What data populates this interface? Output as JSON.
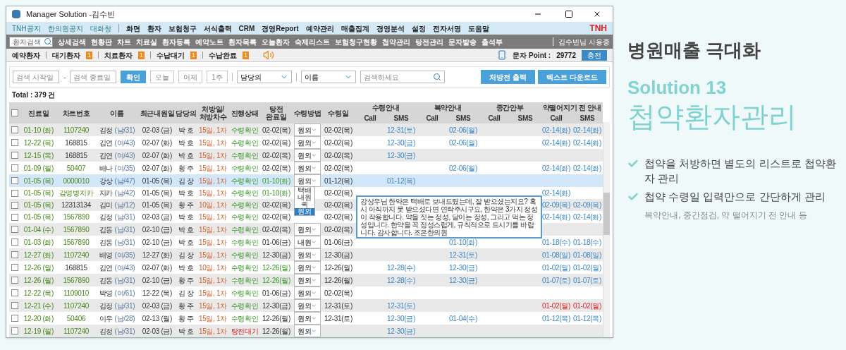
{
  "window": {
    "title": "Manager Solution -김수빈"
  },
  "menu_bar": {
    "notices": [
      "TNH공지",
      "한의원공지",
      "대화창"
    ],
    "items": [
      "화면",
      "환자",
      "보험청구",
      "서식출력",
      "CRM",
      "경영Report",
      "예약관리",
      "매출집계",
      "경영분석",
      "설정",
      "전자서명",
      "도움말"
    ],
    "brand": "TNH"
  },
  "toolbar": {
    "search": {
      "placeholder": "환자검색"
    },
    "items": [
      "상세검색",
      "현황판",
      "차트",
      "치료실",
      "환자등록",
      "예약노트",
      "환자목록",
      "오늘환자",
      "숙제리스트",
      "보험청구현황",
      "첩약관리",
      "탕전관리",
      "문자발송",
      "출석부"
    ],
    "user": "김수빈님 사용중"
  },
  "status_tabs": [
    {
      "label": "예약환자"
    },
    {
      "label": "대기환자",
      "count": "1"
    },
    {
      "label": "치료환자",
      "count": "1"
    },
    {
      "label": "수납대기",
      "count": "1"
    },
    {
      "label": "수납완료",
      "count": "1"
    }
  ],
  "sms_points": {
    "label": "문자 Point :",
    "value": "29772",
    "button": "충전"
  },
  "filter": {
    "start": {
      "placeholder": "검색 시작일"
    },
    "separator": "-",
    "end": {
      "placeholder": "검색 종료일"
    },
    "confirm": "확인",
    "ranges": [
      "오늘",
      "어제",
      "1주"
    ],
    "doctor_select": "담당의",
    "field_select": "이름",
    "query": {
      "placeholder": "검색하세요"
    },
    "actions": [
      "처방전 출력",
      "텍스트 다운로드"
    ]
  },
  "total": "Total : 379 건",
  "table": {
    "all_checked": false,
    "columns": [
      "진료일",
      "차트번호",
      "이름",
      "최근내원일",
      "담당의",
      "처방일/\n처방차수",
      "진행상태",
      "탕전\n완료일",
      "수령방법",
      "수령일"
    ],
    "groups": [
      {
        "label": "수령안내",
        "sub": [
          "Call",
          "SMS"
        ]
      },
      {
        "label": "복약안내",
        "sub": [
          "Call",
          "SMS"
        ]
      },
      {
        "label": "중간안부",
        "sub": [
          "Call",
          "SMS"
        ]
      },
      {
        "label": "약떨어지기 전 안내",
        "sub": [
          "Call",
          "SMS"
        ]
      }
    ],
    "rows": [
      {
        "date": "01-10 (화)",
        "chart": "1107240",
        "chart_green": true,
        "name": "김정",
        "info": "(남/31)",
        "last_visit": "02-03 (금)",
        "doctor": "박 호",
        "rx": "15일, 1차",
        "status": {
          "text": "수령확인",
          "kind": "received"
        },
        "decoction": "02-02(목)",
        "decoction_green": false,
        "method": "원외",
        "receive": "02-02(목)",
        "notes": {
          "guide_sms": "12-31(토)",
          "dose_sms": "02-06(월)",
          "end_call": "02-14(화)",
          "end_sms": "02-14(화)"
        },
        "overdue": false,
        "checked": false,
        "selected": false
      },
      {
        "date": "12-22 (목)",
        "chart": "168815",
        "chart_green": false,
        "name": "김연",
        "info": "(여/43)",
        "last_visit": "02-07 (화)",
        "doctor": "박 호",
        "rx": "15일, 1차",
        "status": {
          "text": "수령확인",
          "kind": "received"
        },
        "decoction": "02-02(목)",
        "decoction_green": false,
        "method": "원외",
        "receive": "02-02(목)",
        "notes": {
          "guide_sms": "12-30(금)",
          "dose_sms": "02-06(월)",
          "end_call": "02-14(화)",
          "end_sms": "02-14(화)"
        },
        "overdue": false,
        "checked": false,
        "selected": false
      },
      {
        "date": "12-15 (목)",
        "chart": "168815",
        "chart_green": false,
        "name": "김연",
        "info": "(여/43)",
        "last_visit": "02-07 (화)",
        "doctor": "박 호",
        "rx": "15일, 1차",
        "status": {
          "text": "수령확인",
          "kind": "received"
        },
        "decoction": "02-02(목)",
        "decoction_green": false,
        "method": "원외",
        "receive": "02-02(목)",
        "notes": {
          "guide_sms": "12-30(금)"
        },
        "checked": false,
        "selected": false
      },
      {
        "date": "01-09 (월)",
        "chart": "50407",
        "chart_green": true,
        "name": "배나",
        "info": "(여/35)",
        "last_visit": "02-07 (화)",
        "doctor": "황 주",
        "rx": "15일, 1차",
        "status": {
          "text": "수령확인",
          "kind": "received"
        },
        "decoction": "02-02(목)",
        "decoction_green": false,
        "method": "원외",
        "receive": "02-02(목)",
        "notes": {
          "dose_sms": "02-06(월)",
          "end_call": "02-14(화)",
          "end_sms": "02-14(화)"
        },
        "overdue": false,
        "checked": false,
        "selected": false
      },
      {
        "date": "01-05 (목)",
        "chart": "0000010",
        "chart_green": true,
        "name": "강상",
        "info": "(남/47)",
        "last_visit": "01-05 (목)",
        "doctor": "김 장",
        "rx": "15일, 1차",
        "status": {
          "text": "수령확인",
          "kind": "received"
        },
        "decoction": "01-10(화)",
        "decoction_green": true,
        "method": "원외",
        "method_menu": [
          {
            "label": "택배",
            "selected": false
          },
          {
            "label": "내원",
            "selected": false
          },
          {
            "label": "퀵",
            "selected": false
          },
          {
            "label": "원외",
            "selected": true
          }
        ],
        "receive": "01-12(목)",
        "notes": {
          "guide_sms": "01-12(목)"
        },
        "checked": false,
        "selected": true
      },
      {
        "date": "01-05 (목)",
        "chart": "감영병지카",
        "chart_green": true,
        "name": "지카",
        "info": "(남/42)",
        "last_visit": "01-05 (목)",
        "doctor": "박 호",
        "rx": "15일, 1차",
        "status": {
          "text": "수령확인",
          "kind": "received"
        },
        "decoction": "01-10(화)",
        "decoction_green": true,
        "receive": "02-02(목)",
        "notes": {
          "end_call": "02-14(화)"
        },
        "memo": "강상우님 한약은 택배로 보내드렸는데, 잘 받으셨는지요? 혹시 아직까지 못 받으셨다면 연락주시구요, 한약은 3가지 정성이 작용합니다. 약을 짓는 정성, 달이는 정성, 그리고 먹는 정성입니다. 한약을 꼭 정성스럽게, 규칙적으로 드시기를 바랍니다. 감사합니다. 조은한의원",
        "overdue": false,
        "checked": false,
        "selected": false
      },
      {
        "date": "01-05 (목)",
        "chart": "12313134",
        "chart_green": false,
        "name": "김미",
        "info": "(남/12)",
        "last_visit": "01-05 (목)",
        "doctor": "황 주",
        "rx": "10일, 1차",
        "status": {
          "text": "수령확인",
          "kind": "received"
        },
        "decoction": "02-02(목)",
        "decoction_green": false,
        "receive": "02-02(목)",
        "notes": {
          "end_call": "02-09(목)",
          "end_sms": "02-09(목)"
        },
        "overdue": false,
        "checked": false,
        "selected": false
      },
      {
        "date": "01-05 (목)",
        "chart": "1567890",
        "chart_green": true,
        "name": "김정",
        "info": "(남/31)",
        "last_visit": "02-03 (금)",
        "doctor": "박 호",
        "rx": "15일, 1차",
        "status": {
          "text": "수령확인",
          "kind": "received"
        },
        "decoction": "02-02(목)",
        "decoction_green": false,
        "receive": "02-02(목)",
        "notes": {
          "end_call": "02-14(화)",
          "end_sms": "02-14(화)"
        },
        "overdue": false,
        "checked": false,
        "selected": false
      },
      {
        "date": "01-04 (수)",
        "chart": "1567890",
        "chart_green": true,
        "name": "김동",
        "info": "(남/31)",
        "last_visit": "02-10 (금)",
        "doctor": "박 호",
        "rx": "15일, 1차",
        "status": {
          "text": "수령확인",
          "kind": "received"
        },
        "decoction": "02-02(목)",
        "decoction_green": false,
        "method": "원외",
        "receive": "02-02(목)",
        "notes": {},
        "checked": false,
        "selected": false
      },
      {
        "date": "01-03 (화)",
        "chart": "1567890",
        "chart_green": true,
        "name": "김동",
        "info": "(남/31)",
        "last_visit": "02-10 (금)",
        "doctor": "박 호",
        "rx": "15일, 1차",
        "status": {
          "text": "수령확인",
          "kind": "received"
        },
        "decoction": "01-06(금)",
        "decoction_green": false,
        "method": "내원",
        "receive": "01-06(금)",
        "notes": {
          "dose_sms": "01-10(화)",
          "end_call": "01-18(수)",
          "end_sms": "01-18(수)"
        },
        "overdue": false,
        "checked": false,
        "selected": false
      },
      {
        "date": "12-27 (화)",
        "chart": "1107240",
        "chart_green": true,
        "name": "배영",
        "info": "(여/35)",
        "last_visit": "12-27 (화)",
        "doctor": "김 장",
        "rx": "15일, 1차",
        "status": {
          "text": "수령확인",
          "kind": "received"
        },
        "decoction": "12-30(금)",
        "decoction_green": false,
        "method": "원외",
        "receive": "12-30(금)",
        "notes": {
          "dose_sms": "12-31(토)",
          "end_call": "01-08(일)",
          "end_sms": "01-08(일)"
        },
        "overdue": false,
        "checked": false,
        "selected": false
      },
      {
        "date": "12-26 (월)",
        "chart": "168815",
        "chart_green": false,
        "name": "김연",
        "info": "(여/43)",
        "last_visit": "02-07 (화)",
        "doctor": "박 호",
        "rx": "10일, 1차",
        "status": {
          "text": "수령확인",
          "kind": "received"
        },
        "decoction": "12-26(월)",
        "decoction_green": true,
        "method": "원외",
        "receive": "12-26(월)",
        "notes": {
          "guide_sms": "12-28(수)",
          "dose_sms": "12-30(금)",
          "end_call": "01-02(월)",
          "end_sms": "01-02(월)"
        },
        "overdue": false,
        "checked": false,
        "selected": false
      },
      {
        "date": "12-26 (월)",
        "chart": "1567890",
        "chart_green": true,
        "name": "김동",
        "info": "(남/31)",
        "last_visit": "02-10 (금)",
        "doctor": "황 주",
        "rx": "15일, 1차",
        "status": {
          "text": "수령확인",
          "kind": "received"
        },
        "decoction": "12-26(월)",
        "decoction_green": true,
        "method": "원외",
        "receive": "12-26(월)",
        "notes": {
          "guide_sms": "12-28(수)",
          "dose_sms": "12-30(금)",
          "end_call": "01-07(토)",
          "end_sms": "01-07(토)"
        },
        "overdue": false,
        "checked": false,
        "selected": false
      },
      {
        "date": "12-22 (목)",
        "chart": "1109010",
        "chart_green": true,
        "name": "박영",
        "info": "(여/61)",
        "last_visit": "12-22 (목)",
        "doctor": "김 장",
        "rx": "15일, 1차",
        "status": {
          "text": "수령확인",
          "kind": "received"
        },
        "decoction": "01-06(금)",
        "decoction_green": false,
        "method": "원외",
        "receive": "02-02(목)",
        "notes": {},
        "checked": false,
        "selected": false
      },
      {
        "date": "12-21 (수)",
        "chart": "1107240",
        "chart_green": true,
        "name": "김정",
        "info": "(남/31)",
        "last_visit": "02-03 (금)",
        "doctor": "황 주",
        "rx": "15일, 1차",
        "status": {
          "text": "수령확인",
          "kind": "received"
        },
        "decoction": "12-30(금)",
        "decoction_green": false,
        "method": "원외",
        "receive": "12-31(토)",
        "notes": {
          "guide_sms": "12-31(토)",
          "end_call": "01-02(월)",
          "end_sms": "01-02(월)"
        },
        "overdue": true,
        "checked": false,
        "selected": false
      },
      {
        "date": "12-20 (화)",
        "chart": "50406",
        "chart_green": true,
        "name": "이우",
        "info": "(남/28)",
        "last_visit": "02-13 (월)",
        "doctor": "황 주",
        "rx": "15일, 1차",
        "status": {
          "text": "수령확인",
          "kind": "received"
        },
        "decoction": "12-26(월)",
        "decoction_green": false,
        "method": "원외",
        "receive": "12-31(토)",
        "notes": {
          "guide_sms": "12-30(금)",
          "dose_sms": "01-04(수)",
          "end_call": "01-12(목)",
          "end_sms": "01-12(목)"
        },
        "overdue": false,
        "checked": false,
        "selected": false
      },
      {
        "date": "12-19 (월)",
        "chart": "1107240",
        "chart_green": true,
        "name": "김정",
        "info": "(남/31)",
        "last_visit": "02-03 (금)",
        "doctor": "박 호",
        "rx": "15일, 1차",
        "status": {
          "text": "탕전대기",
          "kind": "waiting"
        },
        "decoction": "12-26(월)",
        "decoction_green": false,
        "method": "원외",
        "notes": {
          "guide_sms": "12-30(금)"
        },
        "checked": false,
        "selected": false
      }
    ]
  },
  "promo": {
    "headline": "병원매출 극대화",
    "solution": "Solution 13",
    "title": "첩약환자관리",
    "points": [
      "첩약을 처방하면 별도의 리스트로 첩약환자 관리",
      "첩약 수령일 입력만으로 간단하게 관리"
    ],
    "note": "복약안내, 중간점검, 약 떨어지기 전 안내 등"
  }
}
